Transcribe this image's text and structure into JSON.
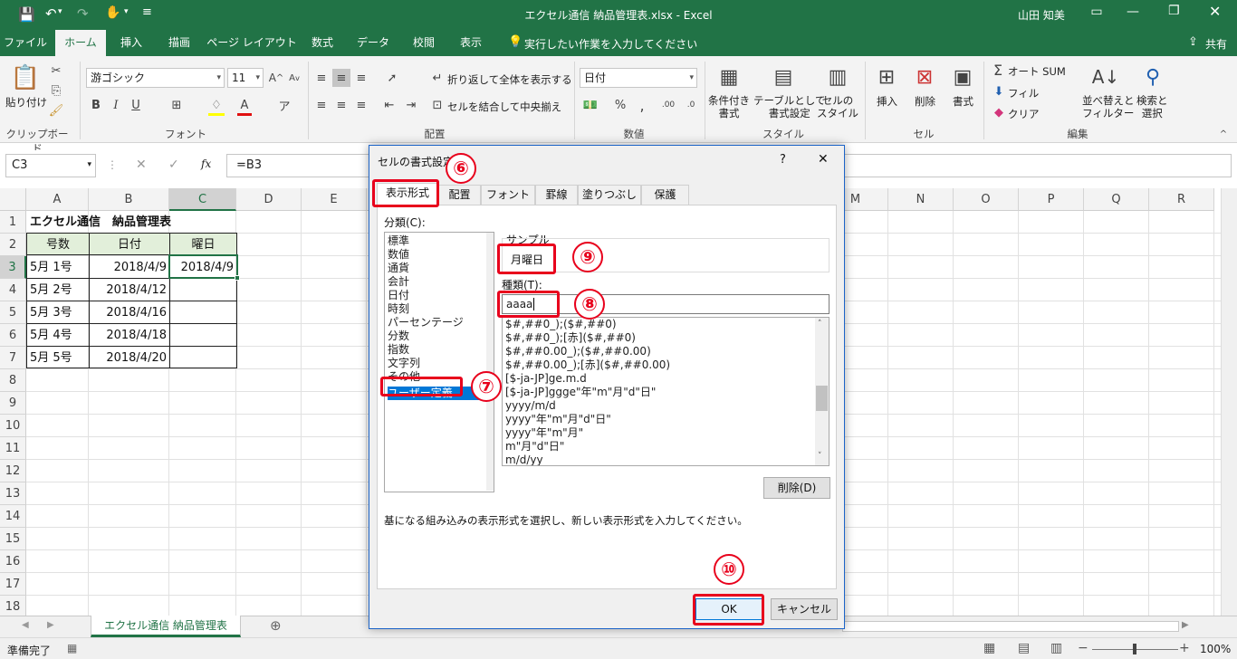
{
  "window": {
    "title": "エクセル通信 納品管理表.xlsx  -  Excel",
    "user": "山田 知美",
    "share": "共有"
  },
  "tabs": [
    "ファイル",
    "ホーム",
    "挿入",
    "描画",
    "ページ レイアウト",
    "数式",
    "データ",
    "校閲",
    "表示"
  ],
  "tell_me": "実行したい作業を入力してください",
  "ribbon": {
    "clipboard": {
      "label": "クリップボード",
      "paste": "貼り付け"
    },
    "font": {
      "label": "フォント",
      "name": "游ゴシック",
      "size": "11"
    },
    "alignment": {
      "label": "配置",
      "wrap": "折り返して全体を表示する",
      "merge": "セルを結合して中央揃え"
    },
    "number": {
      "label": "数値",
      "format": "日付"
    },
    "styles": {
      "label": "スタイル",
      "conditional": "条件付き\n書式",
      "table": "テーブルとして\n書式設定",
      "cell": "セルの\nスタイル"
    },
    "cells": {
      "label": "セル",
      "insert": "挿入",
      "delete": "削除",
      "format": "書式"
    },
    "editing": {
      "label": "編集",
      "autosum": "オート SUM",
      "fill": "フィル",
      "clear": "クリア",
      "sort": "並べ替えと\nフィルター",
      "find": "検索と\n選択"
    }
  },
  "formula_bar": {
    "name_box": "C3",
    "formula": "=B3",
    "fx": "fx"
  },
  "columns": [
    "A",
    "B",
    "C",
    "D",
    "E",
    "F",
    "G",
    "H",
    "I",
    "J",
    "K",
    "L",
    "M",
    "N",
    "O",
    "P",
    "Q",
    "R"
  ],
  "rows": [
    "1",
    "2",
    "3",
    "4",
    "5",
    "6",
    "7",
    "8",
    "9",
    "10",
    "11",
    "12",
    "13",
    "14",
    "15",
    "16",
    "17",
    "18"
  ],
  "sheet": {
    "title": "エクセル通信　納品管理表",
    "headers": [
      "号数",
      "日付",
      "曜日"
    ],
    "data": [
      [
        "5月 1号",
        "2018/4/9",
        "2018/4/9"
      ],
      [
        "5月 2号",
        "2018/4/12",
        ""
      ],
      [
        "5月 3号",
        "2018/4/16",
        ""
      ],
      [
        "5月 4号",
        "2018/4/18",
        ""
      ],
      [
        "5月 5号",
        "2018/4/20",
        ""
      ]
    ]
  },
  "sheet_tab": "エクセル通信  納品管理表",
  "status": {
    "ready": "準備完了",
    "zoom": "100%"
  },
  "dialog": {
    "title": "セルの書式設定",
    "help": "?",
    "close": "✕",
    "tabs": [
      "表示形式",
      "配置",
      "フォント",
      "罫線",
      "塗りつぶし",
      "保護"
    ],
    "category_label": "分類(C):",
    "categories": [
      "標準",
      "数値",
      "通貨",
      "会計",
      "日付",
      "時刻",
      "パーセンテージ",
      "分数",
      "指数",
      "文字列",
      "その他",
      "ユーザー定義"
    ],
    "sample_label": "サンプル",
    "sample_value": "月曜日",
    "type_label": "種類(T):",
    "type_value": "aaaa",
    "formats": [
      "$#,##0_);($#,##0)",
      "$#,##0_);[赤]($#,##0)",
      "$#,##0.00_);($#,##0.00)",
      "$#,##0.00_);[赤]($#,##0.00)",
      "[$-ja-JP]ge.m.d",
      "[$-ja-JP]ggge\"年\"m\"月\"d\"日\"",
      "yyyy/m/d",
      "yyyy\"年\"m\"月\"d\"日\"",
      "yyyy\"年\"m\"月\"",
      "m\"月\"d\"日\"",
      "m/d/yy"
    ],
    "delete_button": "削除(D)",
    "description": "基になる組み込みの表示形式を選択し、新しい表示形式を入力してください。",
    "ok": "OK",
    "cancel": "キャンセル"
  },
  "annotations": [
    "⑥",
    "⑦",
    "⑧",
    "⑨",
    "⑩"
  ],
  "colors": {
    "excel_green": "#217346",
    "highlight_red": "#e8001c",
    "selection_blue": "#0078d7"
  }
}
